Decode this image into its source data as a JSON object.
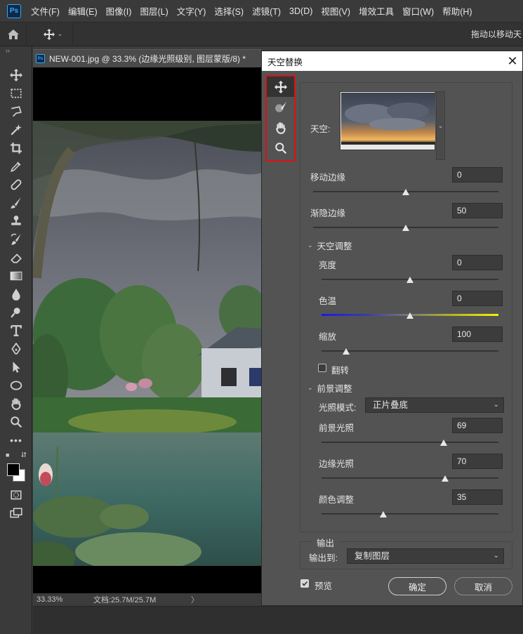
{
  "app": {
    "logo": "Ps",
    "menu": [
      "文件(F)",
      "编辑(E)",
      "图像(I)",
      "图层(L)",
      "文字(Y)",
      "选择(S)",
      "滤镜(T)",
      "3D(D)",
      "视图(V)",
      "增效工具",
      "窗口(W)",
      "帮助(H)"
    ],
    "options_hint": "拖动以移动天"
  },
  "document": {
    "tab_title": "NEW-001.jpg @ 33.3% (边缘光照级别, 图层蒙版/8) *",
    "zoom": "33.33%",
    "doc_info": "文档:25.7M/25.7M",
    "status_arrow": "〉"
  },
  "dialog": {
    "title": "天空替换",
    "close": "✕",
    "sky_label": "天空:",
    "move_edge": {
      "label": "移动边缘",
      "value": "0",
      "level": 0.5
    },
    "fade_edge": {
      "label": "渐隐边缘",
      "value": "50",
      "level": 0.5
    },
    "sky_adjust": {
      "header": "天空调整",
      "brightness": {
        "label": "亮度",
        "value": "0",
        "level": 0.5
      },
      "temperature": {
        "label": "色温",
        "value": "0",
        "level": 0.5
      },
      "scale": {
        "label": "缩放",
        "value": "100",
        "level": 0.14
      },
      "flip": {
        "label": "翻转",
        "checked": false
      }
    },
    "foreground_adjust": {
      "header": "前景调整",
      "lighting_mode": {
        "label": "光照模式:",
        "value": "正片叠底"
      },
      "fg_lighting": {
        "label": "前景光照",
        "value": "69",
        "level": 0.69
      },
      "edge_lighting": {
        "label": "边缘光照",
        "value": "70",
        "level": 0.7
      },
      "color_adjust": {
        "label": "颜色调整",
        "value": "35",
        "level": 0.35
      }
    },
    "output": {
      "legend": "输出",
      "label": "输出到:",
      "value": "复制图层"
    },
    "preview": {
      "label": "预览",
      "checked": true
    },
    "ok": "确定",
    "cancel": "取消"
  },
  "colors": {
    "highlight_box": "#e01010",
    "ps_blue": "#31a8ff",
    "panel_bg": "#535353"
  },
  "icons": {
    "dialog_tools": [
      "move-icon",
      "sky-brush-icon",
      "hand-icon",
      "zoom-icon"
    ]
  }
}
